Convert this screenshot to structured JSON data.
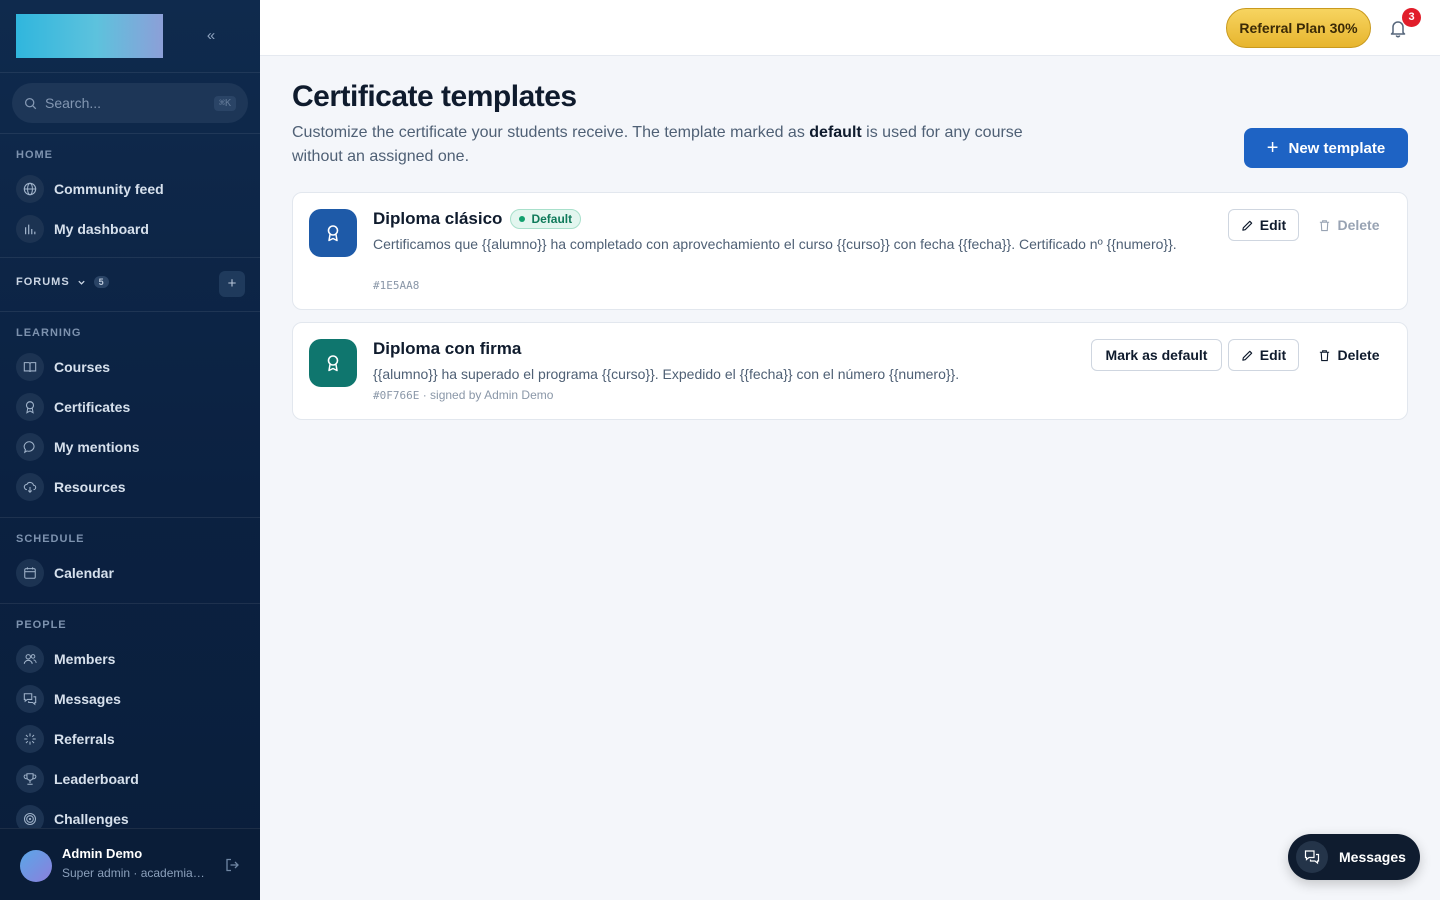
{
  "sidebar": {
    "search_placeholder": "Search...",
    "search_shortcut": "⌘K",
    "sections": {
      "home": "HOME",
      "learning": "LEARNING",
      "schedule": "SCHEDULE",
      "people": "PEOPLE"
    },
    "home_items": [
      {
        "label": "Community feed",
        "icon": "globe-icon"
      },
      {
        "label": "My dashboard",
        "icon": "bar-chart-icon"
      }
    ],
    "forums": {
      "label": "FORUMS",
      "count": "5"
    },
    "learning_items": [
      {
        "label": "Courses",
        "icon": "book-icon"
      },
      {
        "label": "Certificates",
        "icon": "award-icon"
      },
      {
        "label": "My mentions",
        "icon": "chat-bubble-icon"
      },
      {
        "label": "Resources",
        "icon": "cloud-download-icon"
      }
    ],
    "schedule_items": [
      {
        "label": "Calendar",
        "icon": "calendar-icon"
      }
    ],
    "people_items": [
      {
        "label": "Members",
        "icon": "users-icon"
      },
      {
        "label": "Messages",
        "icon": "messages-icon"
      },
      {
        "label": "Referrals",
        "icon": "sparkle-icon"
      },
      {
        "label": "Leaderboard",
        "icon": "trophy-icon"
      },
      {
        "label": "Challenges",
        "icon": "target-icon"
      }
    ],
    "user": {
      "name": "Admin Demo",
      "role": "Super admin · academia-demo"
    }
  },
  "topbar": {
    "referral_label": "Referral Plan 30%",
    "notification_count": "3"
  },
  "main": {
    "title": "Certificate templates",
    "subtitle_pre": "Customize the certificate your students receive. The template marked as ",
    "subtitle_bold": "default",
    "subtitle_post": " is used for any course without an assigned one.",
    "new_button": "New template",
    "templates": [
      {
        "name": "Diploma clásico",
        "default_badge": "Default",
        "body": "Certificamos que {{alumno}} ha completado con aprovechamiento el curso {{curso}} con fecha {{fecha}}. Certificado nº {{numero}}.",
        "color_hex": "#1E5AA8",
        "meta_extra": "",
        "edit_label": "Edit",
        "delete_label": "Delete"
      },
      {
        "name": "Diploma con firma",
        "body": "{{alumno}} ha superado el programa {{curso}}. Expedido el {{fecha}} con el número {{numero}}.",
        "color_hex": "#0F766E",
        "meta_extra": " · signed by Admin Demo",
        "mark_default_label": "Mark as default",
        "edit_label": "Edit",
        "delete_label": "Delete"
      }
    ]
  },
  "floating": {
    "messages_label": "Messages"
  },
  "colors": {
    "sidebar_bg": "#0f2a4d",
    "primary": "#1e63c4",
    "referral_gold": "#f0c44a",
    "badge_red": "#e11d2a"
  }
}
